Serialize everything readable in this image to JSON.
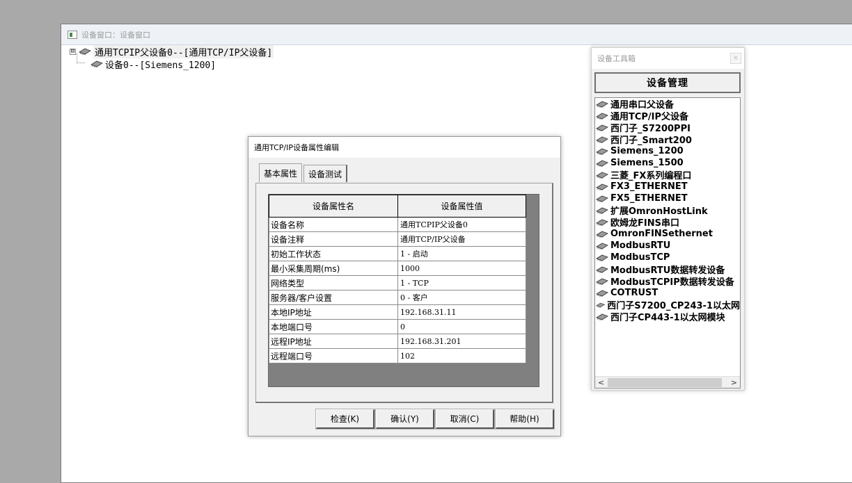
{
  "device_window": {
    "title": "设备窗口：设备窗口",
    "tree": {
      "parent_expander": "⊟",
      "parent_label": "通用TCPIP父设备0--[通用TCP/IP父设备]",
      "child_label": "设备0--[Siemens_1200]"
    }
  },
  "toolbox": {
    "title": "设备工具箱",
    "close": "×",
    "manage_button": "设备管理",
    "items": [
      "通用串口父设备",
      "通用TCP/IP父设备",
      "西门子_S7200PPI",
      "西门子_Smart200",
      "Siemens_1200",
      "Siemens_1500",
      "三菱_FX系列编程口",
      "FX3_ETHERNET",
      "FX5_ETHERNET",
      "扩展OmronHostLink",
      "欧姆龙FINS串口",
      "OmronFINSethernet",
      "ModbusRTU",
      "ModbusTCP",
      "ModbusRTU数据转发设备",
      "ModbusTCPIP数据转发设备",
      "COTRUST",
      "西门子S7200_CP243-1以太网",
      "西门子CP443-1以太网模块"
    ],
    "scroll_left": "<",
    "scroll_right": ">"
  },
  "dialog": {
    "title": "通用TCP/IP设备属性编辑",
    "tabs": [
      "基本属性",
      "设备测试"
    ],
    "table": {
      "headers": [
        "设备属性名",
        "设备属性值"
      ],
      "rows": [
        [
          "设备名称",
          "通用TCPIP父设备0"
        ],
        [
          "设备注释",
          "通用TCP/IP父设备"
        ],
        [
          "初始工作状态",
          "1 - 启动"
        ],
        [
          "最小采集周期(ms)",
          "1000"
        ],
        [
          "网络类型",
          "1 - TCP"
        ],
        [
          "服务器/客户设置",
          "0 - 客户"
        ],
        [
          "本地IP地址",
          "192.168.31.11"
        ],
        [
          "本地端口号",
          "0"
        ],
        [
          "远程IP地址",
          "192.168.31.201"
        ],
        [
          "远程端口号",
          "102"
        ]
      ]
    },
    "buttons": {
      "check": "检查(K)",
      "confirm": "确认(Y)",
      "cancel": "取消(C)",
      "help": "帮助(H)"
    }
  }
}
